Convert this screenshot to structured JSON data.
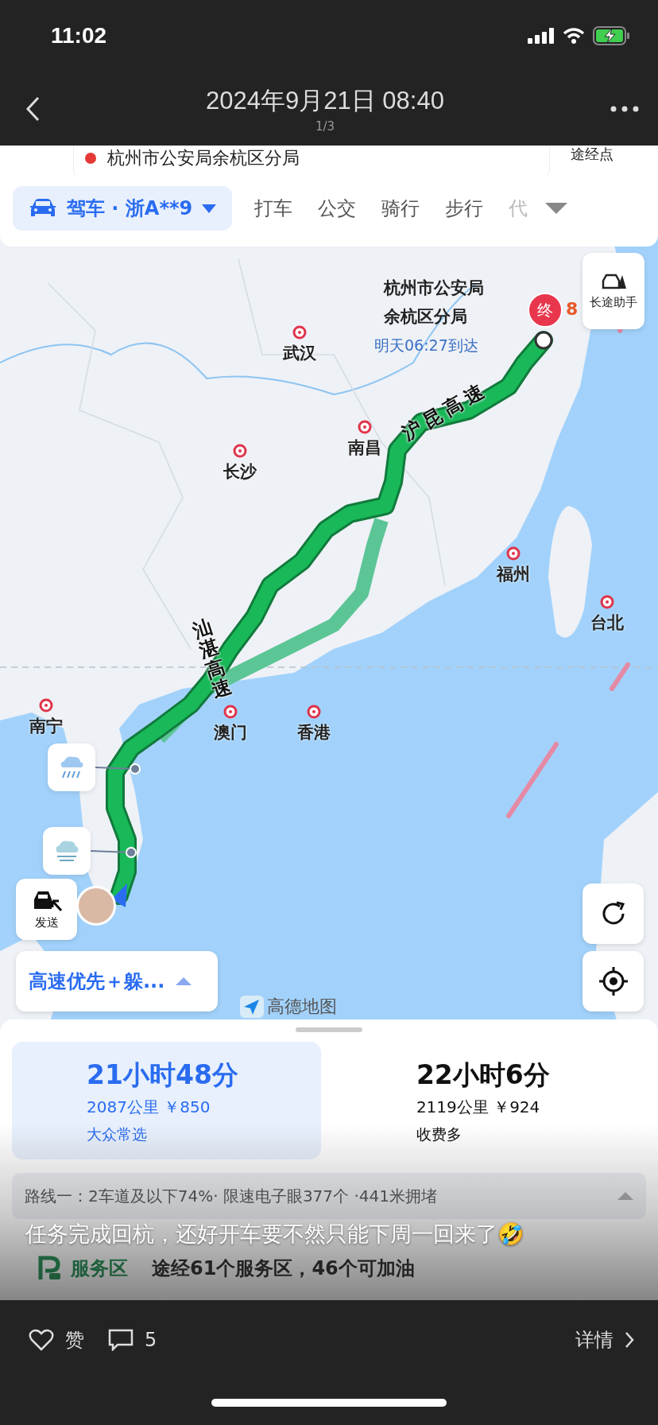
{
  "status_bar": {
    "time": "11:02"
  },
  "header": {
    "title": "2024年9月21日 08:40",
    "counter": "1/3"
  },
  "search": {
    "destination": "杭州市公安局余杭区分局",
    "waypoint": "途经点"
  },
  "modes": [
    {
      "label": "驾车 · 浙A**9",
      "selected": true
    },
    {
      "label": "打车",
      "selected": false
    },
    {
      "label": "公交",
      "selected": false
    },
    {
      "label": "骑行",
      "selected": false
    },
    {
      "label": "步行",
      "selected": false
    },
    {
      "label": "代",
      "selected": false
    }
  ],
  "map": {
    "destination_label": [
      "杭州市公安局",
      "余杭区分局"
    ],
    "arrival": "明天06:27到达",
    "end_pin": "终",
    "pin_count": "8",
    "assistant": "长途助手",
    "send": "发送",
    "preference": "高速优先＋躲...",
    "logo": "高德地图",
    "cities": [
      {
        "name": "武汉"
      },
      {
        "name": "南昌"
      },
      {
        "name": "长沙"
      },
      {
        "name": "福州"
      },
      {
        "name": "台北"
      },
      {
        "name": "南宁"
      },
      {
        "name": "澳门"
      },
      {
        "name": "香港"
      }
    ],
    "highways": [
      {
        "name": "沪昆高速",
        "kind": "slanted"
      },
      {
        "name": "汕湛高速",
        "kind": "stacked"
      }
    ]
  },
  "routes": [
    {
      "time": "21小时48分",
      "distance": "2087公里 ￥850",
      "tag": "大众常选",
      "selected": true
    },
    {
      "time": "22小时6分",
      "distance": "2119公里 ￥924",
      "tag": "收费多",
      "selected": false
    }
  ],
  "route_info": "路线一：2车道及以下74%· 限速电子眼377个 ·441米拥堵",
  "service": {
    "label": "服务区",
    "text": "途经61个服务区，46个可加油"
  },
  "caption": "任务完成回杭，还好开车要不然只能下周一回来了🤣",
  "actions": {
    "like": "赞",
    "comments": "5",
    "details": "详情"
  }
}
